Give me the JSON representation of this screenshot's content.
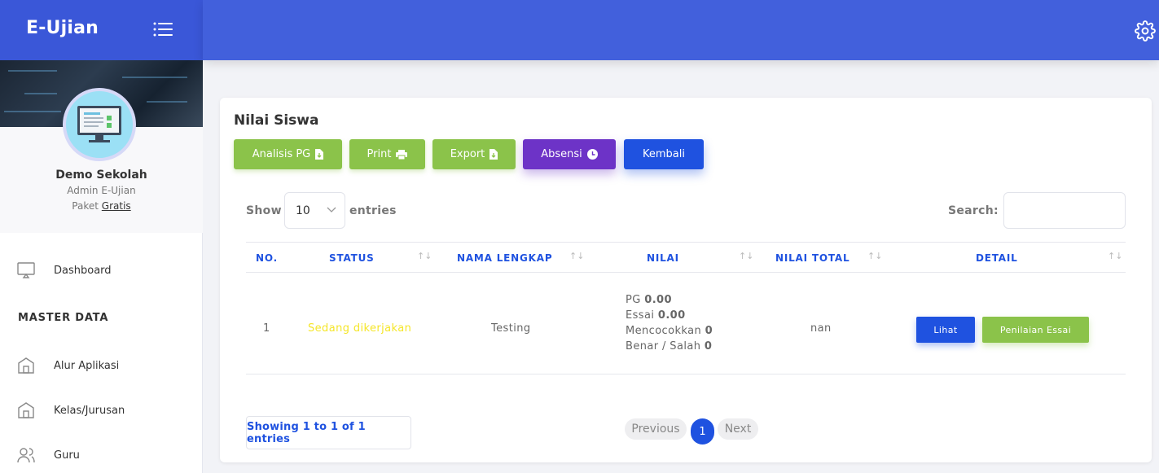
{
  "brand": {
    "title": "E-Ujian"
  },
  "profile": {
    "name": "Demo Sekolah",
    "role": "Admin E-Ujian",
    "package_prefix": "Paket",
    "package_name": "Gratis"
  },
  "sidebar": {
    "dashboard": "Dashboard",
    "section": "MASTER DATA",
    "items": [
      {
        "label": "Alur Aplikasi",
        "icon": "building-icon"
      },
      {
        "label": "Kelas/Jurusan",
        "icon": "building-icon"
      },
      {
        "label": "Guru",
        "icon": "users-icon"
      }
    ]
  },
  "card": {
    "title": "Nilai Siswa",
    "buttons": {
      "analisis": "Analisis PG",
      "print": "Print",
      "export": "Export",
      "absensi": "Absensi",
      "kembali": "Kembali"
    }
  },
  "table_controls": {
    "show": "Show",
    "entries_value": "10",
    "entries": "entries",
    "search": "Search:",
    "search_value": ""
  },
  "table": {
    "headers": [
      "NO.",
      "STATUS",
      "NAMA LENGKAP",
      "NILAI",
      "NILAI TOTAL",
      "DETAIL"
    ],
    "rows": [
      {
        "no": "1",
        "status": "Sedang dikerjakan",
        "nama": "Testing",
        "nilai": [
          {
            "label": "PG",
            "value": "0.00"
          },
          {
            "label": "Essai",
            "value": "0.00"
          },
          {
            "label": "Mencocokkan",
            "value": "0"
          },
          {
            "label": "Benar / Salah",
            "value": "0"
          }
        ],
        "total": "nan",
        "btn_lihat": "Lihat",
        "btn_essai": "Penilaian Essai"
      }
    ]
  },
  "pagination": {
    "info": "Showing 1 to 1 of 1 entries",
    "previous": "Previous",
    "current": "1",
    "next": "Next"
  },
  "colors": {
    "primary": "#1f52e0",
    "topbar": "#4260dc",
    "green": "#8bc34a",
    "purple": "#6d33c7",
    "status_yellow": "#f5e629"
  }
}
